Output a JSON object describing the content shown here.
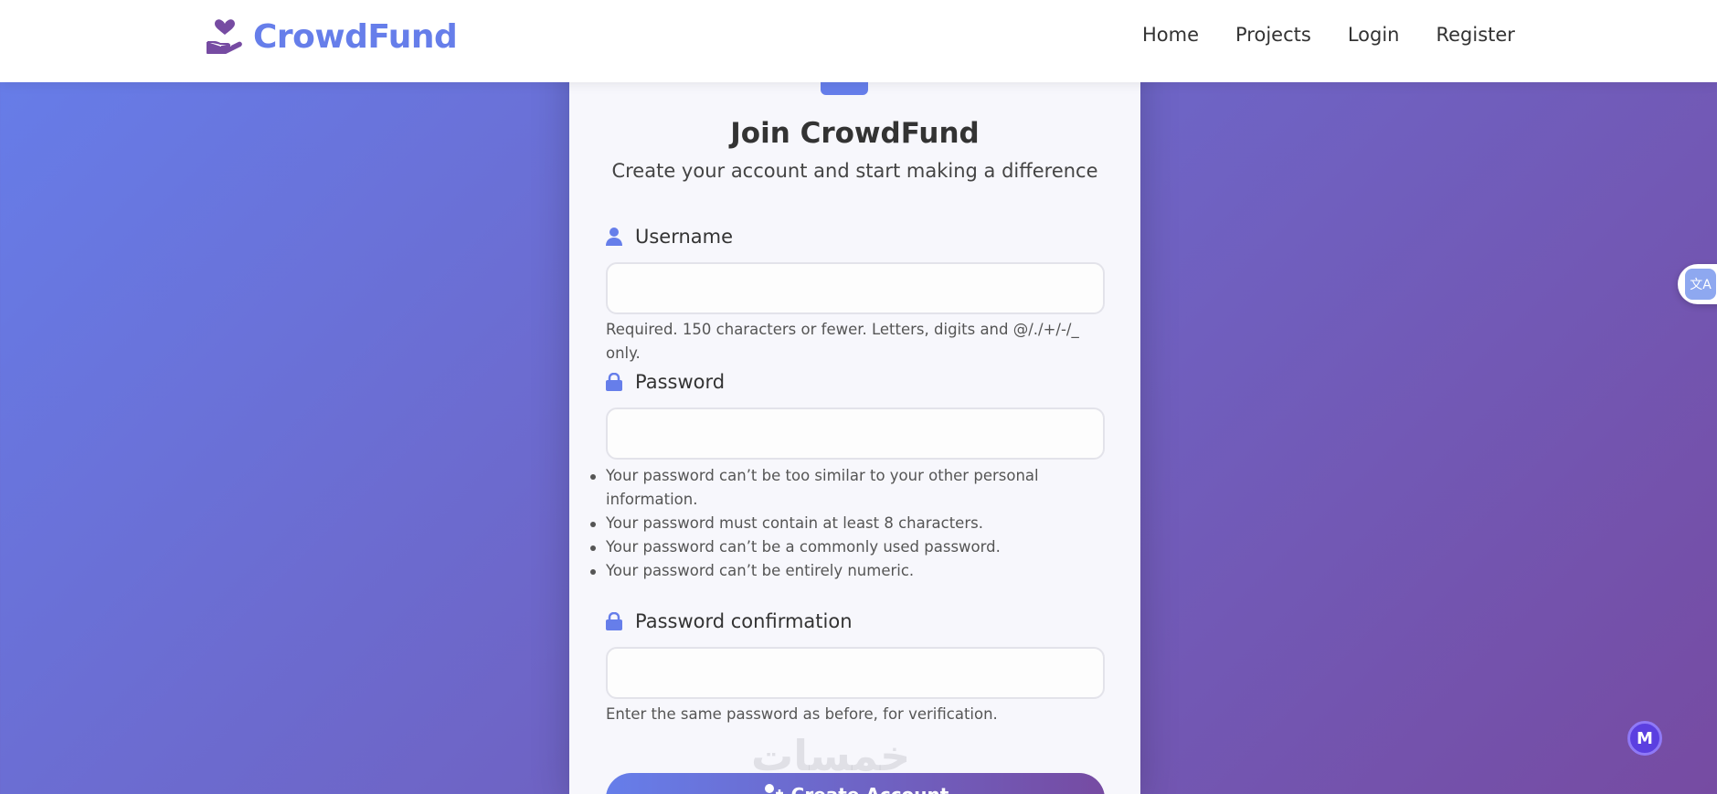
{
  "brand": {
    "name": "CrowdFund",
    "icon": "hand-heart-icon"
  },
  "nav": {
    "items": [
      {
        "label": "Home"
      },
      {
        "label": "Projects"
      },
      {
        "label": "Login"
      },
      {
        "label": "Register"
      }
    ]
  },
  "form": {
    "title": "Join CrowdFund",
    "subtitle": "Create your account and start making a difference",
    "username": {
      "label": "Username",
      "icon": "user-icon",
      "value": "",
      "help": "Required. 150 characters or fewer. Letters, digits and @/./+/-/_ only."
    },
    "password": {
      "label": "Password",
      "icon": "lock-icon",
      "value": "",
      "help_items": [
        "Your password can’t be too similar to your other personal information.",
        "Your password must contain at least 8 characters.",
        "Your password can’t be a commonly used password.",
        "Your password can’t be entirely numeric."
      ]
    },
    "password_confirmation": {
      "label": "Password confirmation",
      "icon": "lock-icon",
      "value": "",
      "help": "Enter the same password as before, for verification."
    },
    "submit": {
      "label": "Create Account",
      "icon": "user-plus-icon"
    }
  },
  "watermark": "خمسات",
  "widgets": {
    "translate": {
      "icon": "translate-icon",
      "label": "文A"
    },
    "assistant": {
      "icon": "m-logo-icon",
      "label": "M"
    }
  },
  "colors": {
    "accent": "#667eea",
    "gradient_end": "#764ba2"
  }
}
